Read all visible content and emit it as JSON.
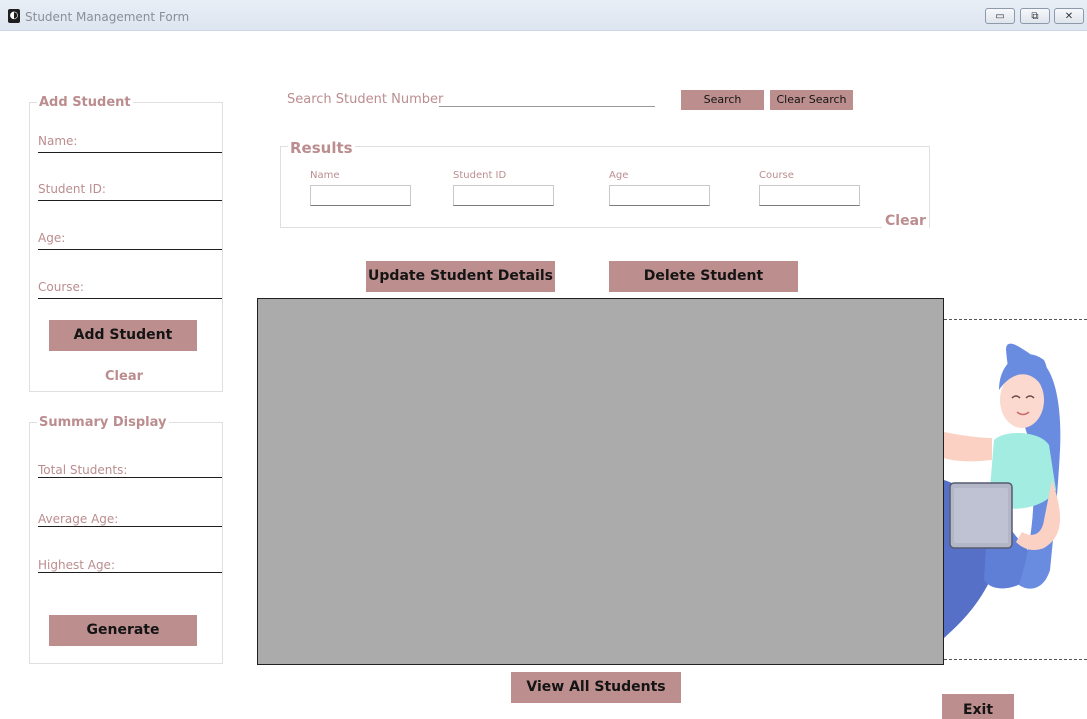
{
  "window": {
    "title": "Student Management Form",
    "controls": {
      "minimize": "▭",
      "maximize": "⧉",
      "close": "✕"
    }
  },
  "add_student": {
    "legend": "Add Student",
    "fields": [
      {
        "label": "Name:"
      },
      {
        "label": "Student ID:"
      },
      {
        "label": "Age:"
      },
      {
        "label": "Course:"
      }
    ],
    "add_button": "Add Student",
    "clear_link": "Clear"
  },
  "summary": {
    "legend": "Summary Display",
    "fields": [
      {
        "label": "Total Students:"
      },
      {
        "label": "Average Age:"
      },
      {
        "label": "Highest Age:"
      }
    ],
    "generate_button": "Generate"
  },
  "search": {
    "label": "Search Student Number",
    "value": "",
    "search_button": "Search",
    "clear_search_button": "Clear Search"
  },
  "results": {
    "legend": "Results",
    "columns": [
      "Name",
      "Student ID",
      "Age",
      "Course"
    ],
    "values": [
      "",
      "",
      "",
      ""
    ],
    "clear_link": "Clear"
  },
  "actions": {
    "update_button": "Update Student Details",
    "delete_button": "Delete Student",
    "view_all_button": "View All Students",
    "exit_button": "Exit"
  },
  "colors": {
    "accent": "#bd8e8e",
    "label_text": "#bb8d8f",
    "table_bg": "#ababab"
  },
  "illustration": {
    "icon": "student-with-laptop-illustration"
  }
}
